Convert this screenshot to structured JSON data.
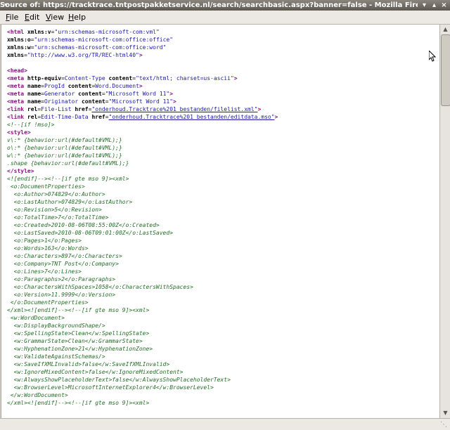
{
  "window": {
    "title": "Source of: https://tracktrace.tntpostpakketservice.nl/search/searchbasic.aspx?banner=false - Mozilla Firefox"
  },
  "menu": {
    "file": {
      "accel": "F",
      "rest": "ile"
    },
    "edit": {
      "accel": "E",
      "rest": "dit"
    },
    "view": {
      "accel": "V",
      "rest": "iew"
    },
    "help": {
      "accel": "H",
      "rest": "elp"
    }
  },
  "source": {
    "lines": [
      {
        "parts": [
          {
            "t": "<html ",
            "c": "tag"
          },
          {
            "t": "xmlns:v",
            "c": "attr"
          },
          {
            "t": "=",
            "c": ""
          },
          {
            "t": "\"urn:schemas-microsoft-com:vml\"",
            "c": "val"
          }
        ]
      },
      {
        "parts": [
          {
            "t": "xmlns:o",
            "c": "attr"
          },
          {
            "t": "=",
            "c": ""
          },
          {
            "t": "\"urn:schemas-microsoft-com:office:office\"",
            "c": "val"
          }
        ]
      },
      {
        "parts": [
          {
            "t": "xmlns:w",
            "c": "attr"
          },
          {
            "t": "=",
            "c": ""
          },
          {
            "t": "\"urn:schemas-microsoft-com:office:word\"",
            "c": "val"
          }
        ]
      },
      {
        "parts": [
          {
            "t": "xmlns",
            "c": "attr"
          },
          {
            "t": "=",
            "c": ""
          },
          {
            "t": "\"http://www.w3.org/TR/REC-html40\"",
            "c": "val"
          },
          {
            "t": ">",
            "c": "tag"
          }
        ]
      },
      {
        "parts": []
      },
      {
        "parts": [
          {
            "t": "<head>",
            "c": "tag"
          }
        ]
      },
      {
        "parts": [
          {
            "t": "<meta ",
            "c": "tag"
          },
          {
            "t": "http-equiv",
            "c": "attr"
          },
          {
            "t": "=",
            "c": ""
          },
          {
            "t": "Content-Type ",
            "c": "val"
          },
          {
            "t": "content",
            "c": "attr"
          },
          {
            "t": "=",
            "c": ""
          },
          {
            "t": "\"text/html; charset=us-ascii\"",
            "c": "val"
          },
          {
            "t": ">",
            "c": "tag"
          }
        ]
      },
      {
        "parts": [
          {
            "t": "<meta ",
            "c": "tag"
          },
          {
            "t": "name",
            "c": "attr"
          },
          {
            "t": "=",
            "c": ""
          },
          {
            "t": "ProgId ",
            "c": "val"
          },
          {
            "t": "content",
            "c": "attr"
          },
          {
            "t": "=",
            "c": ""
          },
          {
            "t": "Word.Document",
            "c": "val"
          },
          {
            "t": ">",
            "c": "tag"
          }
        ]
      },
      {
        "parts": [
          {
            "t": "<meta ",
            "c": "tag"
          },
          {
            "t": "name",
            "c": "attr"
          },
          {
            "t": "=",
            "c": ""
          },
          {
            "t": "Generator ",
            "c": "val"
          },
          {
            "t": "content",
            "c": "attr"
          },
          {
            "t": "=",
            "c": ""
          },
          {
            "t": "\"Microsoft Word 11\"",
            "c": "val"
          },
          {
            "t": ">",
            "c": "tag"
          }
        ]
      },
      {
        "parts": [
          {
            "t": "<meta ",
            "c": "tag"
          },
          {
            "t": "name",
            "c": "attr"
          },
          {
            "t": "=",
            "c": ""
          },
          {
            "t": "Originator ",
            "c": "val"
          },
          {
            "t": "content",
            "c": "attr"
          },
          {
            "t": "=",
            "c": ""
          },
          {
            "t": "\"Microsoft Word 11\"",
            "c": "val"
          },
          {
            "t": ">",
            "c": "tag"
          }
        ]
      },
      {
        "parts": [
          {
            "t": "<link ",
            "c": "tag"
          },
          {
            "t": "rel",
            "c": "attr"
          },
          {
            "t": "=",
            "c": ""
          },
          {
            "t": "File-List ",
            "c": "val"
          },
          {
            "t": "href",
            "c": "attr"
          },
          {
            "t": "=",
            "c": ""
          },
          {
            "t": "\"onderhoud.Tracktrace%201_bestanden/filelist.xml\"",
            "c": "lnk"
          },
          {
            "t": ">",
            "c": "tag"
          }
        ]
      },
      {
        "parts": [
          {
            "t": "<link ",
            "c": "tag"
          },
          {
            "t": "rel",
            "c": "attr"
          },
          {
            "t": "=",
            "c": ""
          },
          {
            "t": "Edit-Time-Data ",
            "c": "val"
          },
          {
            "t": "href",
            "c": "attr"
          },
          {
            "t": "=",
            "c": ""
          },
          {
            "t": "\"onderhoud.Tracktrace%201_bestanden/editdata.mso\"",
            "c": "lnk"
          },
          {
            "t": ">",
            "c": "tag"
          }
        ]
      },
      {
        "parts": [
          {
            "t": "<!--[if !mso]>",
            "c": "cmt"
          }
        ]
      },
      {
        "parts": [
          {
            "t": "<style>",
            "c": "tag"
          }
        ]
      },
      {
        "parts": [
          {
            "t": "v\\:* {behavior:url(#default#VML);}",
            "c": "cmt"
          }
        ]
      },
      {
        "parts": [
          {
            "t": "o\\:* {behavior:url(#default#VML);}",
            "c": "cmt"
          }
        ]
      },
      {
        "parts": [
          {
            "t": "w\\:* {behavior:url(#default#VML);}",
            "c": "cmt"
          }
        ]
      },
      {
        "parts": [
          {
            "t": ".shape {behavior:url(#default#VML);}",
            "c": "cmt"
          }
        ]
      },
      {
        "parts": [
          {
            "t": "</style>",
            "c": "tag"
          }
        ]
      },
      {
        "parts": [
          {
            "t": "<![endif]--><!--[if gte mso 9]><xml>",
            "c": "cmt"
          }
        ]
      },
      {
        "parts": [
          {
            "t": " <o:DocumentProperties>",
            "c": "cmt"
          }
        ]
      },
      {
        "parts": [
          {
            "t": "  <o:Author>074829</o:Author>",
            "c": "cmt"
          }
        ]
      },
      {
        "parts": [
          {
            "t": "  <o:LastAuthor>074829</o:LastAuthor>",
            "c": "cmt"
          }
        ]
      },
      {
        "parts": [
          {
            "t": "  <o:Revision>5</o:Revision>",
            "c": "cmt"
          }
        ]
      },
      {
        "parts": [
          {
            "t": "  <o:TotalTime>7</o:TotalTime>",
            "c": "cmt"
          }
        ]
      },
      {
        "parts": [
          {
            "t": "  <o:Created>2010-08-06T08:55:00Z</o:Created>",
            "c": "cmt"
          }
        ]
      },
      {
        "parts": [
          {
            "t": "  <o:LastSaved>2010-08-06T09:01:00Z</o:LastSaved>",
            "c": "cmt"
          }
        ]
      },
      {
        "parts": [
          {
            "t": "  <o:Pages>1</o:Pages>",
            "c": "cmt"
          }
        ]
      },
      {
        "parts": [
          {
            "t": "  <o:Words>163</o:Words>",
            "c": "cmt"
          }
        ]
      },
      {
        "parts": [
          {
            "t": "  <o:Characters>897</o:Characters>",
            "c": "cmt"
          }
        ]
      },
      {
        "parts": [
          {
            "t": "  <o:Company>TNT Post</o:Company>",
            "c": "cmt"
          }
        ]
      },
      {
        "parts": [
          {
            "t": "  <o:Lines>7</o:Lines>",
            "c": "cmt"
          }
        ]
      },
      {
        "parts": [
          {
            "t": "  <o:Paragraphs>2</o:Paragraphs>",
            "c": "cmt"
          }
        ]
      },
      {
        "parts": [
          {
            "t": "  <o:CharactersWithSpaces>1058</o:CharactersWithSpaces>",
            "c": "cmt"
          }
        ]
      },
      {
        "parts": [
          {
            "t": "  <o:Version>11.9999</o:Version>",
            "c": "cmt"
          }
        ]
      },
      {
        "parts": [
          {
            "t": " </o:DocumentProperties>",
            "c": "cmt"
          }
        ]
      },
      {
        "parts": [
          {
            "t": "</xml><![endif]--><!--[if gte mso 9]><xml>",
            "c": "cmt"
          }
        ]
      },
      {
        "parts": [
          {
            "t": " <w:WordDocument>",
            "c": "cmt"
          }
        ]
      },
      {
        "parts": [
          {
            "t": "  <w:DisplayBackgroundShape/>",
            "c": "cmt"
          }
        ]
      },
      {
        "parts": [
          {
            "t": "  <w:SpellingState>Clean</w:SpellingState>",
            "c": "cmt"
          }
        ]
      },
      {
        "parts": [
          {
            "t": "  <w:GrammarState>Clean</w:GrammarState>",
            "c": "cmt"
          }
        ]
      },
      {
        "parts": [
          {
            "t": "  <w:HyphenationZone>21</w:HyphenationZone>",
            "c": "cmt"
          }
        ]
      },
      {
        "parts": [
          {
            "t": "  <w:ValidateAgainstSchemas/>",
            "c": "cmt"
          }
        ]
      },
      {
        "parts": [
          {
            "t": "  <w:SaveIfXMLInvalid>false</w:SaveIfXMLInvalid>",
            "c": "cmt"
          }
        ]
      },
      {
        "parts": [
          {
            "t": "  <w:IgnoreMixedContent>false</w:IgnoreMixedContent>",
            "c": "cmt"
          }
        ]
      },
      {
        "parts": [
          {
            "t": "  <w:AlwaysShowPlaceholderText>false</w:AlwaysShowPlaceholderText>",
            "c": "cmt"
          }
        ]
      },
      {
        "parts": [
          {
            "t": "  <w:BrowserLevel>MicrosoftInternetExplorer4</w:BrowserLevel>",
            "c": "cmt"
          }
        ]
      },
      {
        "parts": [
          {
            "t": " </w:WordDocument>",
            "c": "cmt"
          }
        ]
      },
      {
        "parts": [
          {
            "t": "</xml><![endif]--><!--[if gte mso 9]><xml>",
            "c": "cmt"
          }
        ]
      }
    ]
  },
  "icons": {
    "window_menu": "window-menu-icon",
    "minimize": "minimize-icon",
    "maximize": "maximize-icon",
    "close": "close-icon",
    "scroll_up": "arrow-up-icon",
    "scroll_down": "arrow-down-icon",
    "resize": "resize-grip-icon",
    "cursor": "mouse-cursor-icon"
  },
  "colors": {
    "tag": "#881280",
    "attribute_value": "#1a1aa6",
    "comment": "#236e25"
  }
}
